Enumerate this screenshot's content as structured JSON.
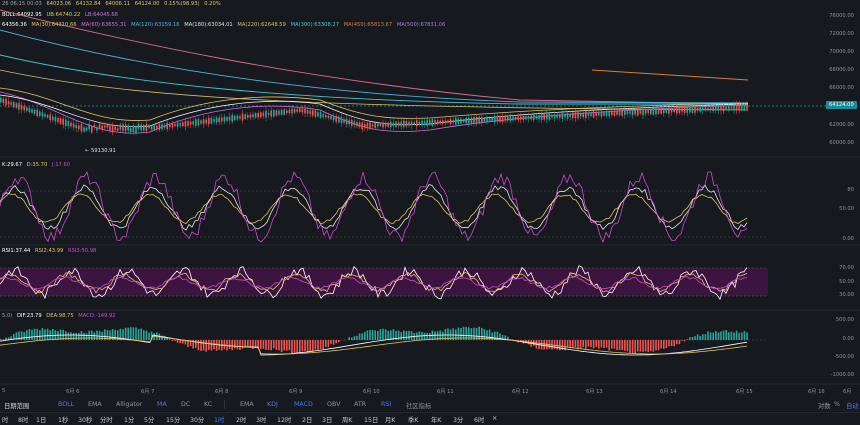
{
  "header": {
    "time": "26 06:15 00:03",
    "ohlc": [
      "64023.06",
      "64132.84",
      "64006.11",
      "64124.00"
    ],
    "change": "0.15%(98.93)",
    "amplitude": "0.20%"
  },
  "boll": {
    "label": "BOLL:64092.95",
    "ub": "UB:64740.22",
    "lb": "LB:64045.68"
  },
  "ma": [
    "64356.36",
    "MA(30):64310.66",
    "MA(60):63655.31",
    "MA(120):63159.16",
    "MA(180):63034.01",
    "MA(220):62648.59",
    "MA(300):63308.27",
    "MA(450):65813.67",
    "MA(500):67831.06"
  ],
  "price_axis": [
    "76000.00",
    "72000.00",
    "70000.00",
    "68000.00",
    "66000.00",
    "64124.00",
    "62000.00",
    "60000.00"
  ],
  "current_price": "64124.00",
  "low_marker": "← 59130.91",
  "kdj": {
    "k": "K:29.67",
    "d": "D:35.70",
    "j": "J:17.60",
    "axis": [
      "80",
      "50.00",
      "0.00"
    ]
  },
  "rsi": {
    "r1": "RSI1:37.44",
    "r2": "RSI2:43.99",
    "r3": "RSI3:50.98",
    "axis": [
      "70.00",
      "50.00",
      "30.00"
    ]
  },
  "macd": {
    "prefix": "5.0)",
    "dif": "DIF:23.79",
    "dea": "DEA:98.75",
    "macd": "MACD:-149.92",
    "axis": [
      "500.00",
      "0.00",
      "-500.00",
      "-1000.00"
    ]
  },
  "dates": [
    "5",
    "6月 6",
    "6月 7",
    "6月 8",
    "6月 9",
    "6月 10",
    "6月 11",
    "6月 12",
    "6月 13",
    "6月 14",
    "6月 15",
    "6月 16",
    "6月"
  ],
  "indicator_bar": {
    "range": "日期范围",
    "items": [
      "BOLL",
      "EMA",
      "Alligator",
      "MA",
      "DC",
      "KC",
      "EMA",
      "KDJ",
      "MACD",
      "OBV",
      "ATR",
      "RSI",
      "社区指标"
    ],
    "right": [
      "对数",
      "%",
      "自动"
    ]
  },
  "interval_bar": {
    "items": [
      "时",
      "8时",
      "1日",
      "1秒",
      "30秒",
      "分时",
      "1分",
      "5分",
      "15分",
      "30分",
      "1时",
      "2时",
      "3时",
      "12时",
      "2日",
      "3日",
      "周K",
      "15日",
      "月K",
      "季K",
      "年K",
      "3分",
      "6时",
      "×"
    ]
  },
  "colors": {
    "bg": "#161A1E",
    "up": "#26a69a",
    "down": "#ef5350",
    "accent": "#3d7bff"
  }
}
